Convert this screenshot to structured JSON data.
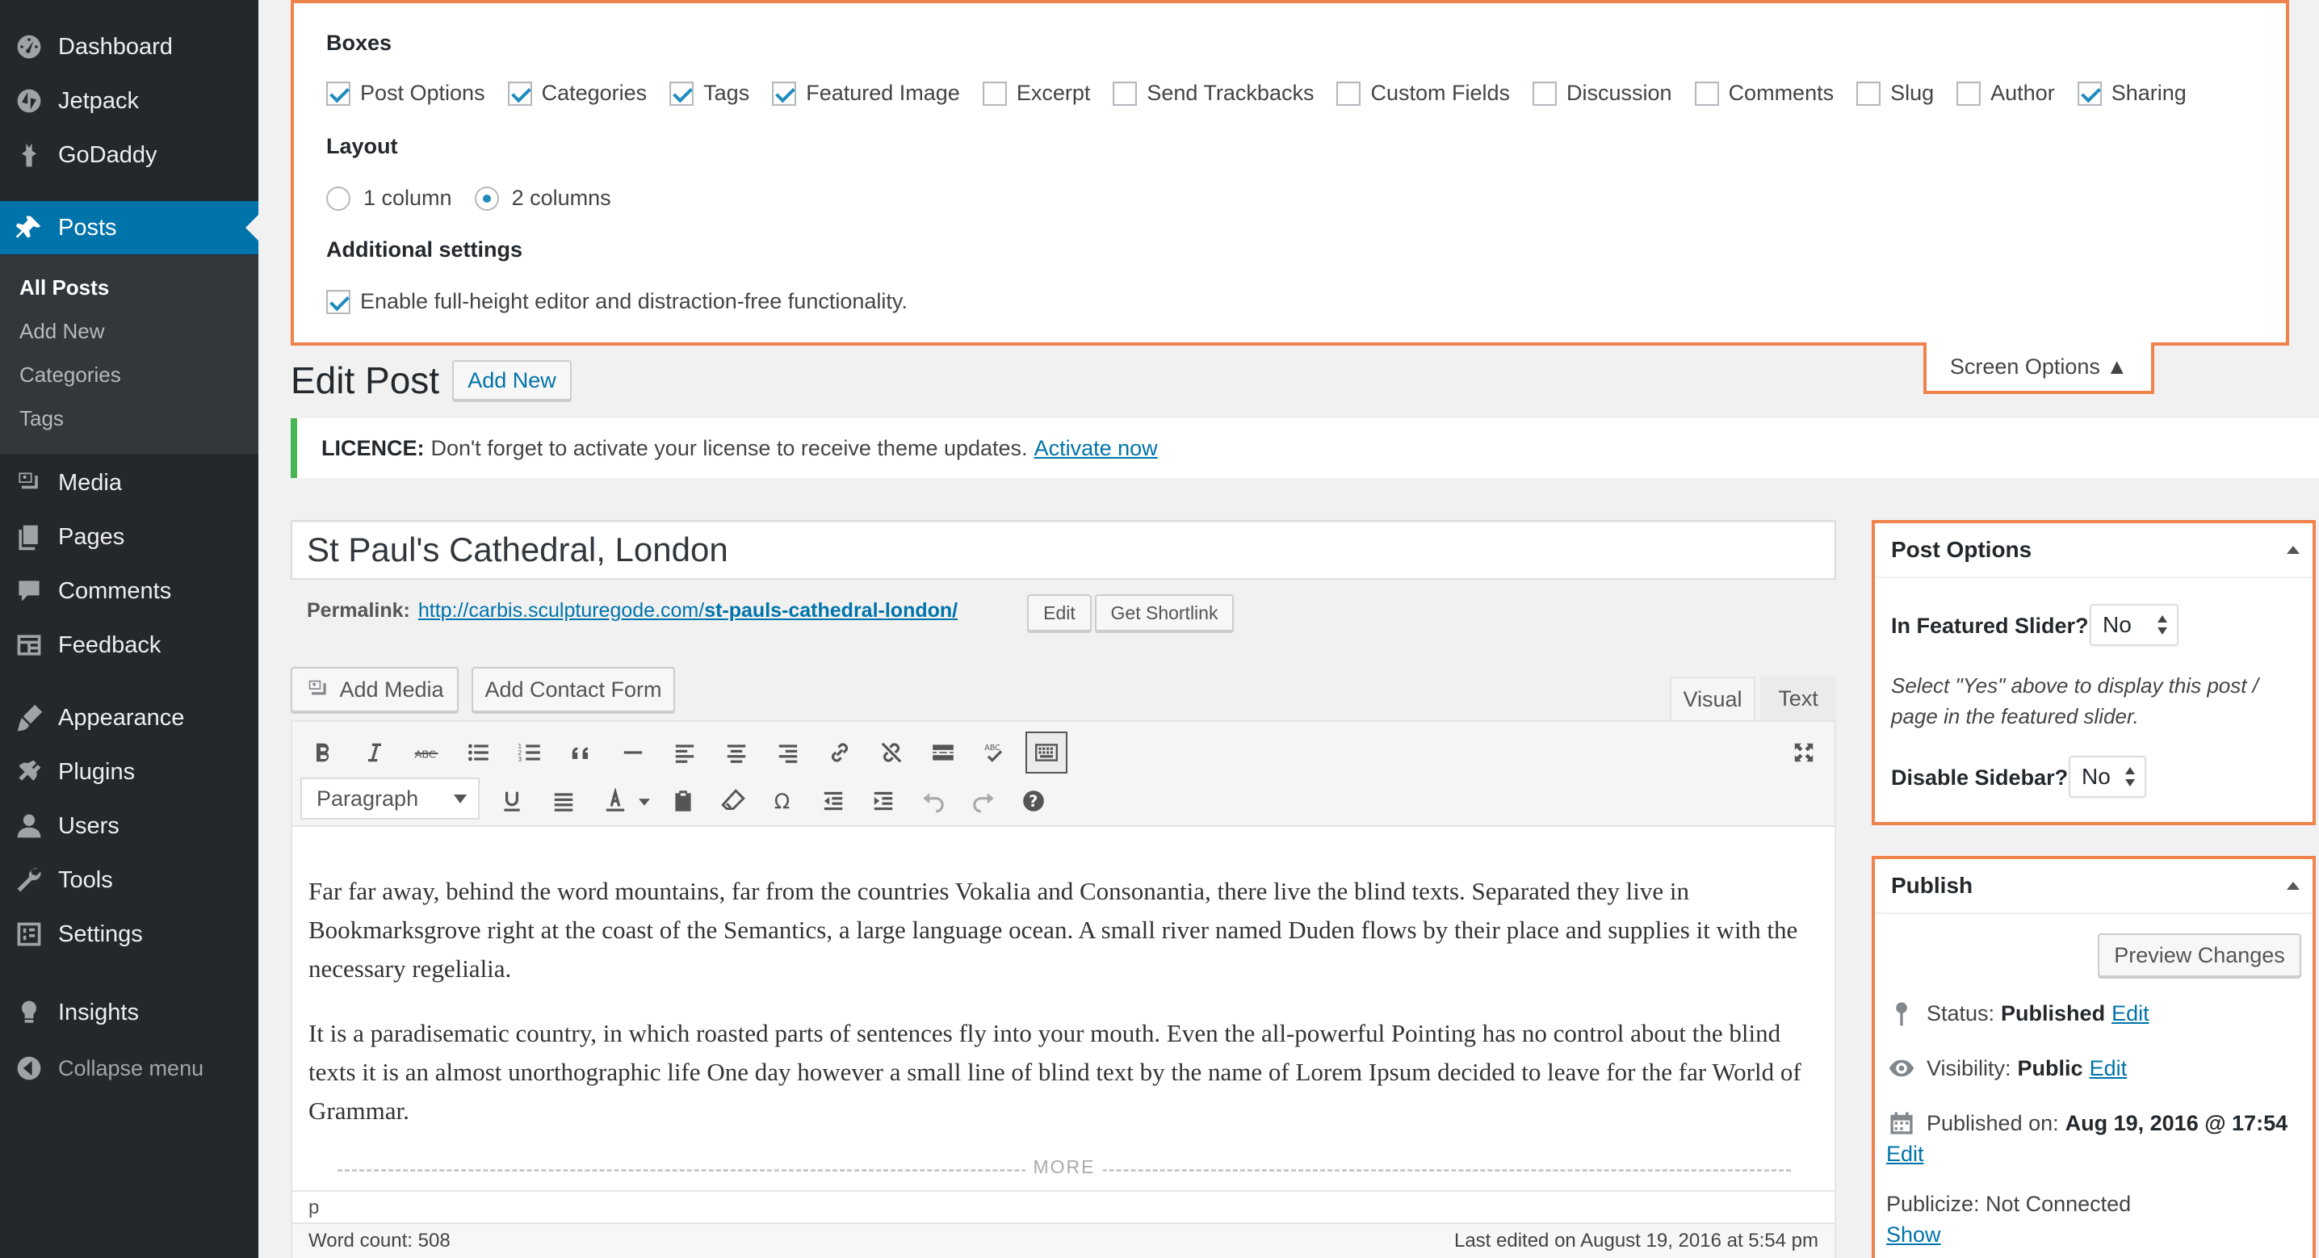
{
  "sidebar": {
    "items": [
      {
        "label": "Dashboard",
        "icon": "dashboard-icon"
      },
      {
        "label": "Jetpack",
        "icon": "jetpack-icon"
      },
      {
        "label": "GoDaddy",
        "icon": "godaddy-icon"
      },
      {
        "label": "Posts",
        "icon": "pin-icon"
      },
      {
        "label": "Media",
        "icon": "media-icon"
      },
      {
        "label": "Pages",
        "icon": "pages-icon"
      },
      {
        "label": "Comments",
        "icon": "comments-icon"
      },
      {
        "label": "Feedback",
        "icon": "feedback-icon"
      },
      {
        "label": "Appearance",
        "icon": "brush-icon"
      },
      {
        "label": "Plugins",
        "icon": "plugin-icon"
      },
      {
        "label": "Users",
        "icon": "users-icon"
      },
      {
        "label": "Tools",
        "icon": "wrench-icon"
      },
      {
        "label": "Settings",
        "icon": "settings-icon"
      },
      {
        "label": "Insights",
        "icon": "insights-icon"
      }
    ],
    "posts_submenu": [
      "All Posts",
      "Add New",
      "Categories",
      "Tags"
    ],
    "collapse_label": "Collapse menu"
  },
  "screen_options": {
    "boxes_heading": "Boxes",
    "boxes": [
      {
        "label": "Post Options",
        "checked": true
      },
      {
        "label": "Categories",
        "checked": true
      },
      {
        "label": "Tags",
        "checked": true
      },
      {
        "label": "Featured Image",
        "checked": true
      },
      {
        "label": "Excerpt",
        "checked": false
      },
      {
        "label": "Send Trackbacks",
        "checked": false
      },
      {
        "label": "Custom Fields",
        "checked": false
      },
      {
        "label": "Discussion",
        "checked": false
      },
      {
        "label": "Comments",
        "checked": false
      },
      {
        "label": "Slug",
        "checked": false
      },
      {
        "label": "Author",
        "checked": false
      },
      {
        "label": "Sharing",
        "checked": true
      }
    ],
    "layout_heading": "Layout",
    "layout_options": [
      {
        "label": "1 column",
        "checked": false
      },
      {
        "label": "2 columns",
        "checked": true
      }
    ],
    "additional_heading": "Additional settings",
    "additional_option": "Enable full-height editor and distraction-free functionality.",
    "tab_label": "Screen Options ▲"
  },
  "header": {
    "title": "Edit Post",
    "add_new": "Add New"
  },
  "notice": {
    "bold": "LICENCE:",
    "text": "Don't forget to activate your license to receive theme updates.",
    "link": "Activate now"
  },
  "post": {
    "title": "St Paul's Cathedral, London",
    "permalink_label": "Permalink:",
    "permalink_base": "http://carbis.sculpturegode.com/",
    "permalink_slug": "st-pauls-cathedral-london/",
    "edit_btn": "Edit",
    "shortlink_btn": "Get Shortlink"
  },
  "editor": {
    "add_media": "Add Media",
    "add_contact_form": "Add Contact Form",
    "tab_visual": "Visual",
    "tab_text": "Text",
    "format": "Paragraph",
    "paragraphs": [
      "Far far away, behind the word mountains, far from the countries Vokalia and Consonantia, there live the blind texts. Separated they live in Bookmarksgrove right at the coast of the Semantics, a large language ocean. A small river named Duden flows by their place and supplies it with the necessary regelialia.",
      "It is a paradisematic country, in which roasted parts of sentences fly into your mouth. Even the all-powerful Pointing has no control about the blind texts it is an almost unorthographic life One day however a small line of blind text by the name of Lorem Ipsum decided to leave for the far World of Grammar."
    ],
    "more_label": "MORE",
    "path": "p",
    "word_count": "Word count: 508",
    "last_edited": "Last edited on August 19, 2016 at 5:54 pm"
  },
  "post_options": {
    "title": "Post Options",
    "featured_label": "In Featured Slider?",
    "featured_value": "No",
    "description": "Select \"Yes\" above to display this post / page in the featured slider.",
    "sidebar_label": "Disable Sidebar?",
    "sidebar_value": "No"
  },
  "publish": {
    "title": "Publish",
    "preview_btn": "Preview Changes",
    "status_label": "Status:",
    "status_value": "Published",
    "visibility_label": "Visibility:",
    "visibility_value": "Public",
    "published_label": "Published on:",
    "published_value": "Aug 19, 2016 @ 17:54",
    "edit_link": "Edit",
    "publicize_text": "Publicize: Not Connected",
    "show_link": "Show"
  },
  "colors": {
    "sidebar_bg": "#23282d",
    "accent": "#0073aa",
    "highlight_border": "#f0824c",
    "notice_green": "#46b450"
  }
}
